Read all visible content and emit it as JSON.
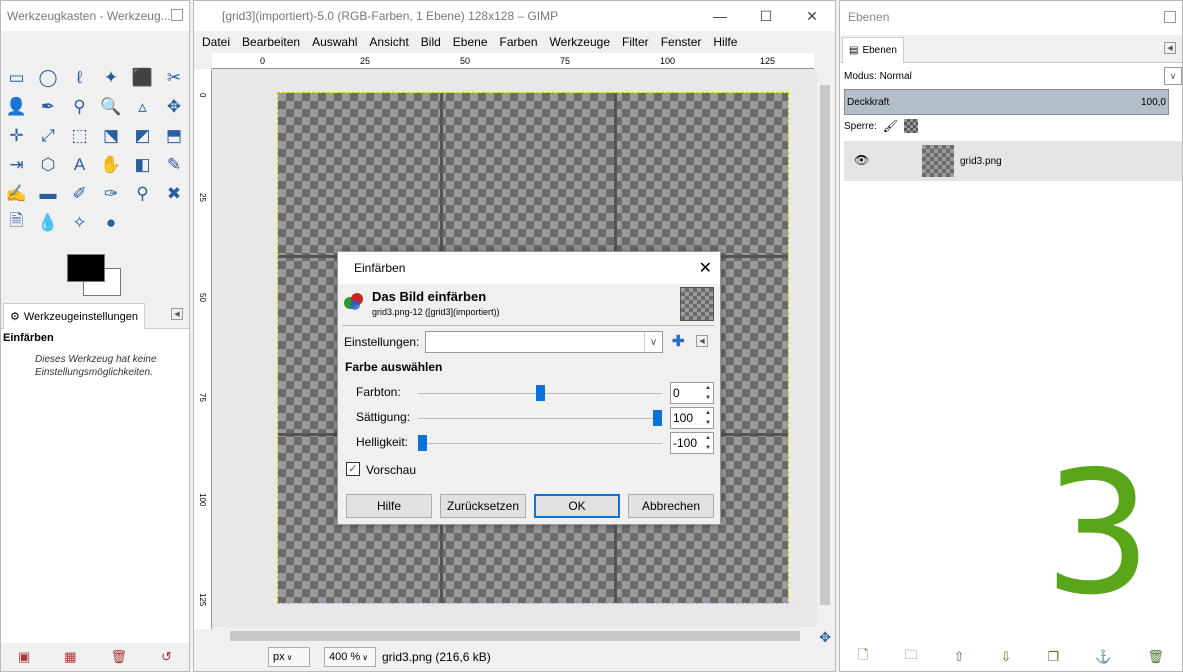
{
  "toolbox": {
    "title": "Werkzeugkasten - Werkzeug...",
    "tab_label": "Werkzeugeinstellungen",
    "tool_name": "Einfärben",
    "tool_note": "Dieses Werkzeug hat keine Einstellungsmöglichkeiten."
  },
  "image_window": {
    "title": "[grid3](importiert)-5.0 (RGB-Farben, 1 Ebene) 128x128 – GIMP",
    "menu": [
      "Datei",
      "Bearbeiten",
      "Auswahl",
      "Ansicht",
      "Bild",
      "Ebene",
      "Farben",
      "Werkzeuge",
      "Filter",
      "Fenster",
      "Hilfe"
    ],
    "ruler_h": [
      "0",
      "25",
      "50",
      "75",
      "100",
      "125"
    ],
    "ruler_v": [
      "0",
      "25",
      "50",
      "75",
      "100",
      "125"
    ],
    "status": {
      "unit": "px",
      "zoom": "400 %",
      "file": "grid3.png (216,6 kB)"
    }
  },
  "dialog": {
    "title": "Einfärben",
    "heading": "Das Bild einfärben",
    "subheading": "grid3.png-12 ([grid3](importiert))",
    "settings_label": "Einstellungen:",
    "settings_value": "",
    "section": "Farbe auswählen",
    "sliders": [
      {
        "label": "Farbton:",
        "value": "0",
        "fraction": 0.5
      },
      {
        "label": "Sättigung:",
        "value": "100",
        "fraction": 1.0
      },
      {
        "label": "Helligkeit:",
        "value": "-100",
        "fraction": 0.0
      }
    ],
    "preview_label": "Vorschau",
    "preview_checked": true,
    "buttons": {
      "help": "Hilfe",
      "reset": "Zurücksetzen",
      "ok": "OK",
      "cancel": "Abbrechen"
    }
  },
  "layers": {
    "title": "Ebenen",
    "tab_label": "Ebenen",
    "mode": "Modus: Normal",
    "opacity_label": "Deckkraft",
    "opacity_value": "100,0",
    "lock_label": "Sperre:",
    "layer_name": "grid3.png",
    "overlay_number": "3"
  },
  "colors": {
    "accent": "#0a73d9",
    "overlay": "#5aa61a"
  }
}
